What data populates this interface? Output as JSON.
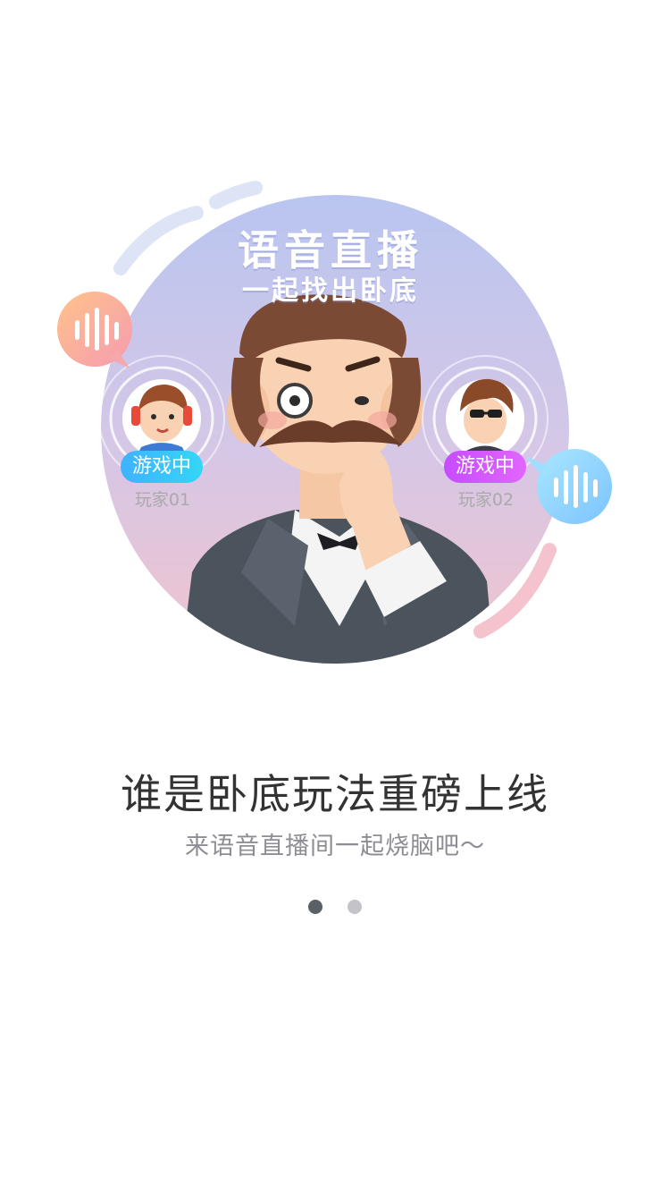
{
  "banner": {
    "title": "语音直播",
    "subtitle": "一起找出卧底"
  },
  "players": [
    {
      "status": "游戏中",
      "name": "玩家01"
    },
    {
      "status": "游戏中",
      "name": "玩家02"
    }
  ],
  "content": {
    "headline": "谁是卧底玩法重磅上线",
    "subline": "来语音直播间一起烧脑吧～"
  },
  "pager": {
    "total": 2,
    "current": 1
  },
  "colors": {
    "headline": "#333333",
    "subline": "#8d8d94",
    "badge_player1": "#3fb2ff",
    "badge_player2": "#c64cff",
    "dot_active": "#5b5f66",
    "dot_inactive": "#c4c4c8"
  }
}
